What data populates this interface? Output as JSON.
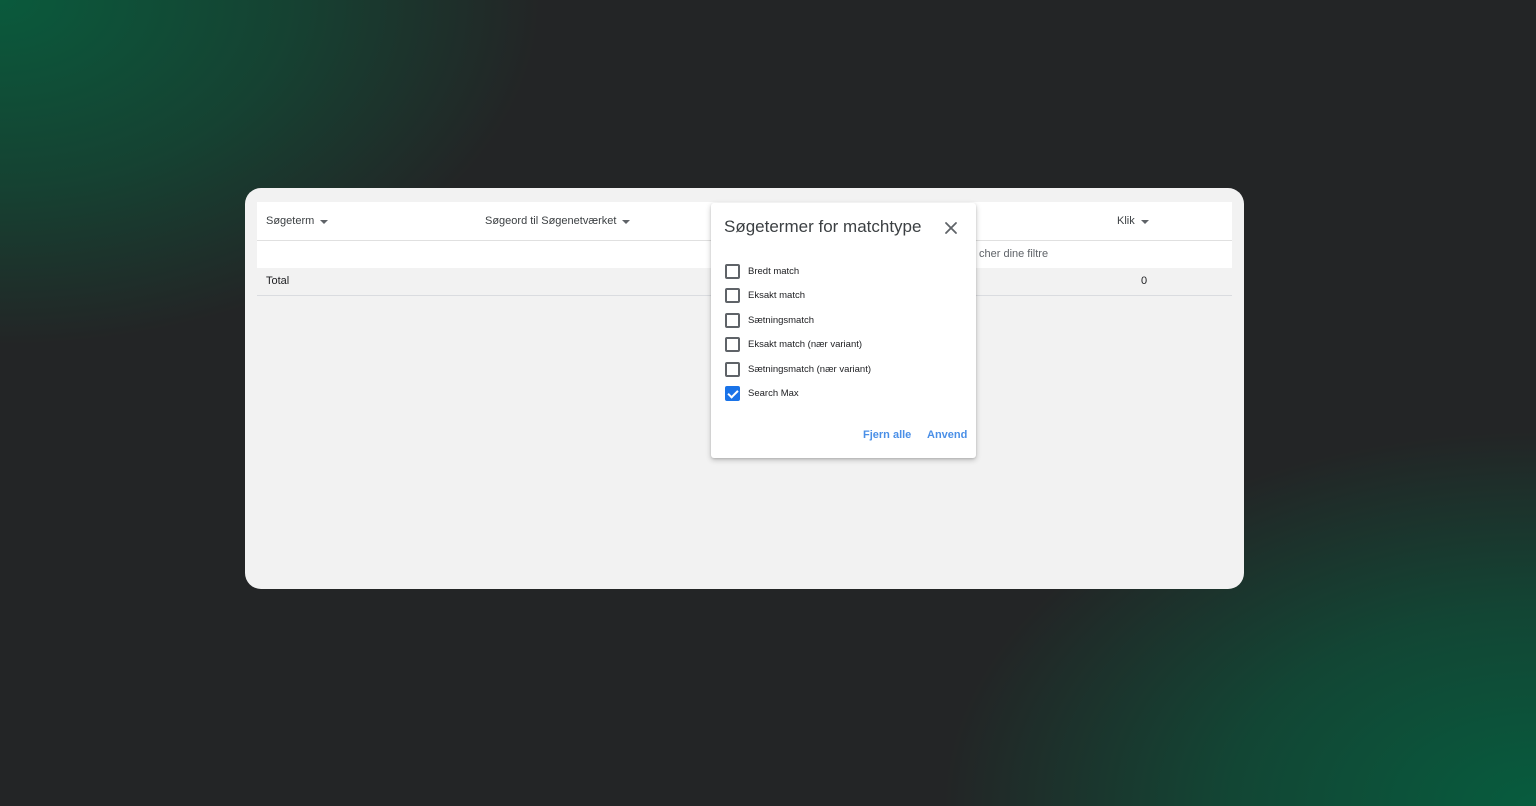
{
  "table": {
    "columns": [
      {
        "label": "Søgeterm"
      },
      {
        "label": "Søgeord til Søgenetværket"
      },
      {
        "label": "Klik"
      }
    ],
    "empty_message": "cher dine filtre",
    "total_label": "Total",
    "total_clicks": "0"
  },
  "filter_popup": {
    "title": "Søgetermer for matchtype",
    "close_icon": "close-icon",
    "options": [
      {
        "label": "Bredt match",
        "checked": false
      },
      {
        "label": "Eksakt match",
        "checked": false
      },
      {
        "label": "Sætningsmatch",
        "checked": false
      },
      {
        "label": "Eksakt match (nær variant)",
        "checked": false
      },
      {
        "label": "Sætningsmatch (nær variant)",
        "checked": false
      },
      {
        "label": "Search Max",
        "checked": true
      }
    ],
    "remove_all_label": "Fjern alle",
    "apply_label": "Anvend"
  },
  "colors": {
    "accent": "#1a73e8",
    "button_text": "#4a8fe7",
    "background_green": "#0a5a3c",
    "background_dark": "#232526"
  }
}
